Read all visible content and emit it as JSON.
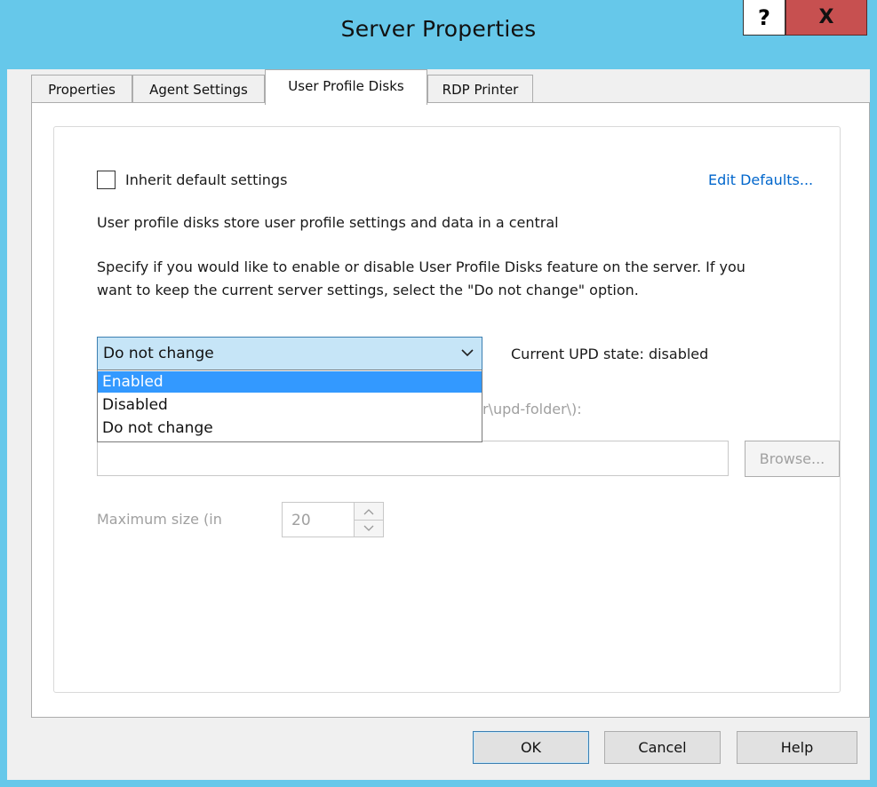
{
  "window": {
    "title": "Server Properties",
    "help_label": "?",
    "close_label": "X"
  },
  "tabs": [
    {
      "label": "Properties",
      "active": false
    },
    {
      "label": "Agent Settings",
      "active": false
    },
    {
      "label": "User Profile Disks",
      "active": true
    },
    {
      "label": "RDP Printer",
      "active": false
    }
  ],
  "upd": {
    "inherit_label": "Inherit default settings",
    "inherit_checked": false,
    "edit_defaults_link": "Edit Defaults...",
    "description_line1": "User profile disks store user profile settings and data in a central",
    "specify_line1": "Specify if you would like to enable or disable User Profile Disks feature on the server. If you",
    "specify_line2": "want to keep the current server settings, select the \"Do not change\" option.",
    "mode_value": "Do not change",
    "mode_options": [
      "Enabled",
      "Disabled",
      "Do not change"
    ],
    "highlighted_option": "Enabled",
    "current_state": "Current UPD state: disabled",
    "location_label_fragment": "r\\upd-folder\\):",
    "location_value": "",
    "browse_label": "Browse...",
    "max_size_label": "Maximum size (in",
    "max_size_value": "20"
  },
  "buttons": {
    "ok": "OK",
    "cancel": "Cancel",
    "help": "Help"
  },
  "colors": {
    "titlebar": "#66c8ea",
    "close": "#c75050",
    "link": "#0066cc",
    "selection": "#3399ff"
  }
}
